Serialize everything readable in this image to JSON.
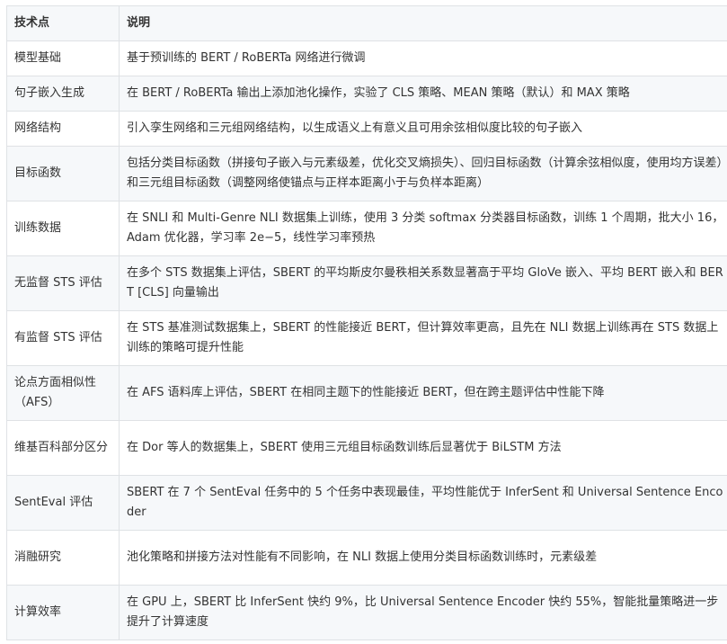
{
  "table": {
    "headers": [
      "技术点",
      "说明"
    ],
    "rows": [
      {
        "point": "模型基础",
        "desc": "基于预训练的 BERT / RoBERTa 网络进行微调"
      },
      {
        "point": "句子嵌入生成",
        "desc": "在 BERT / RoBERTa 输出上添加池化操作，实验了 CLS 策略、MEAN 策略（默认）和 MAX 策略"
      },
      {
        "point": "网络结构",
        "desc": "引入孪生网络和三元组网络结构，以生成语义上有意义且可用余弦相似度比较的句子嵌入"
      },
      {
        "point": "目标函数",
        "desc": "包括分类目标函数（拼接句子嵌入与元素级差，优化交叉熵损失）、回归目标函数（计算余弦相似度，使用均方误差）和三元组目标函数（调整网络使锚点与正样本距离小于与负样本距离）"
      },
      {
        "point": "训练数据",
        "desc": "在 SNLI 和 Multi-Genre NLI 数据集上训练，使用 3 分类 softmax 分类器目标函数，训练 1 个周期，批大小 16，Adam 优化器，学习率 2e−5，线性学习率预热"
      },
      {
        "point": "无监督 STS 评估",
        "desc": "在多个 STS 数据集上评估，SBERT 的平均斯皮尔曼秩相关系数显著高于平均 GloVe 嵌入、平均 BERT 嵌入和 BERT [CLS] 向量输出"
      },
      {
        "point": "有监督 STS 评估",
        "desc": "在 STS 基准测试数据集上，SBERT 的性能接近 BERT，但计算效率更高，且先在 NLI 数据上训练再在 STS 数据上训练的策略可提升性能"
      },
      {
        "point": "论点方面相似性（AFS）",
        "desc": "在 AFS 语料库上评估，SBERT 在相同主题下的性能接近 BERT，但在跨主题评估中性能下降"
      },
      {
        "point": "维基百科部分区分",
        "desc": "在 Dor 等人的数据集上，SBERT 使用三元组目标函数训练后显著优于 BiLSTM 方法"
      },
      {
        "point": "SentEval 评估",
        "desc": "SBERT 在 7 个 SentEval 任务中的 5 个任务中表现最佳，平均性能优于 InferSent 和 Universal Sentence Encoder"
      },
      {
        "point": "消融研究",
        "desc": "池化策略和拼接方法对性能有不同影响，在 NLI 数据上使用分类目标函数训练时，元素级差"
      },
      {
        "point": "计算效率",
        "desc": "在 GPU 上，SBERT 比 InferSent 快约 9%，比 Universal Sentence Encoder 快约 55%，智能批量策略进一步提升了计算速度"
      }
    ]
  }
}
